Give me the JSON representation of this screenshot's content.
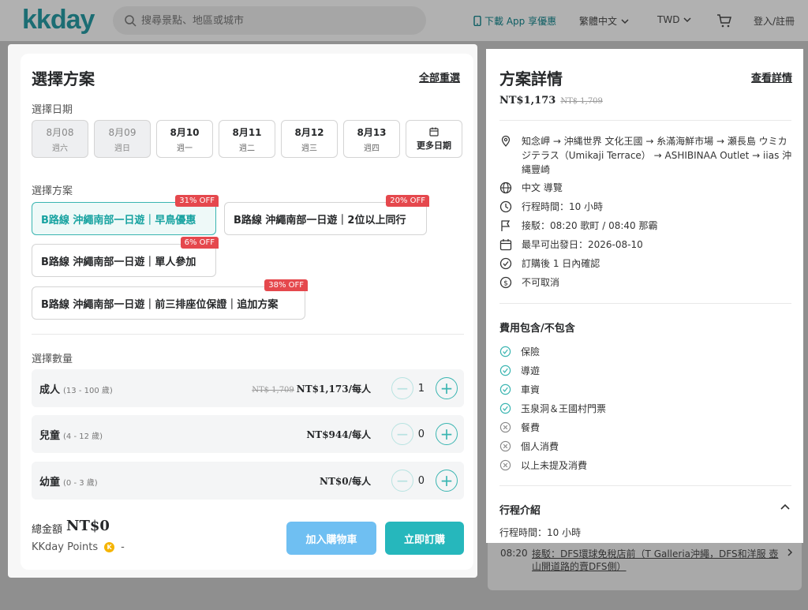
{
  "header": {
    "logo": "kkday",
    "search_placeholder": "搜尋景點、地區或城市",
    "app_download": "下載 App 享優惠",
    "language": "繁體中文",
    "currency": "TWD",
    "login": "登入/註冊"
  },
  "left": {
    "title": "選擇方案",
    "reset": "全部重選",
    "date_label": "選擇日期",
    "dates": [
      {
        "date": "8月08",
        "weekday": "週六",
        "disabled": true
      },
      {
        "date": "8月09",
        "weekday": "週日",
        "disabled": true
      },
      {
        "date": "8月10",
        "weekday": "週一",
        "disabled": false
      },
      {
        "date": "8月11",
        "weekday": "週二",
        "disabled": false
      },
      {
        "date": "8月12",
        "weekday": "週三",
        "disabled": false
      },
      {
        "date": "8月13",
        "weekday": "週四",
        "disabled": false
      }
    ],
    "more_dates": "更多日期",
    "plan_label": "選擇方案",
    "plans": [
      {
        "name": "B路線 沖繩南部一日遊｜早鳥優惠",
        "discount": "31% OFF",
        "selected": true
      },
      {
        "name": "B路線 沖繩南部一日遊｜2位以上同行",
        "discount": "20% OFF",
        "selected": false
      },
      {
        "name": "B路線 沖繩南部一日遊｜單人參加",
        "discount": "6% OFF",
        "selected": false
      },
      {
        "name": "B路線 沖繩南部一日遊｜前三排座位保證｜追加方案",
        "discount": "38% OFF",
        "selected": false
      }
    ],
    "qty_label": "選擇數量",
    "quantities": [
      {
        "name": "成人",
        "age": "(13 - 100 歲)",
        "old_price": "NT$ 1,709",
        "price": "NT$1,173/每人",
        "count": "1"
      },
      {
        "name": "兒童",
        "age": "(4 - 12 歲)",
        "old_price": "",
        "price": "NT$944/每人",
        "count": "0"
      },
      {
        "name": "幼童",
        "age": "(0 - 3 歲)",
        "old_price": "",
        "price": "NT$0/每人",
        "count": "0"
      }
    ],
    "total_label": "總金額",
    "total_value": "NT$0",
    "points_label": "KKday Points",
    "points_coin": "K",
    "points_value": "-",
    "add_cart": "加入購物車",
    "book_now": "立即訂購"
  },
  "right": {
    "title": "方案詳情",
    "view_details": "查看詳情",
    "price": "NT$1,173",
    "old_price": "NT$ 1,709",
    "info": [
      {
        "icon": "location-icon",
        "text": "知念岬 → 沖縄世界 文化王國 → 糸滿海鮮市場 → 瀬長島 ウミカジテラス（Umikaji Terrace） → ASHIBINAA Outlet → iias 沖縄豐崎"
      },
      {
        "icon": "globe-icon",
        "text": "中文 導覽"
      },
      {
        "icon": "clock-icon",
        "text": "行程時間：10 小時"
      },
      {
        "icon": "flag-icon",
        "text": "接駁：08:20 歌町 / 08:40 那霸"
      },
      {
        "icon": "calendar-icon",
        "text": "最早可出發日：2026-08-10"
      },
      {
        "icon": "check-circle-icon",
        "text": "訂購後 1 日內確認"
      },
      {
        "icon": "dollar-icon",
        "text": "不可取消"
      }
    ],
    "includes_title": "費用包含/不包含",
    "includes": [
      {
        "text": "保險",
        "included": true
      },
      {
        "text": "導遊",
        "included": true
      },
      {
        "text": "車資",
        "included": true
      },
      {
        "text": "玉泉洞＆王國村門票",
        "included": true
      },
      {
        "text": "餐費",
        "included": false
      },
      {
        "text": "個人消費",
        "included": false
      },
      {
        "text": "以上未提及消費",
        "included": false
      }
    ],
    "itinerary_title": "行程介紹",
    "itinerary_duration": "行程時間：10 小時",
    "itinerary_time": "08:20",
    "itinerary_stop": "接駁：DFS環球免稅店前（T Galleria沖繩，DFS和洋服 壺山開道路的賣DFS側）"
  }
}
